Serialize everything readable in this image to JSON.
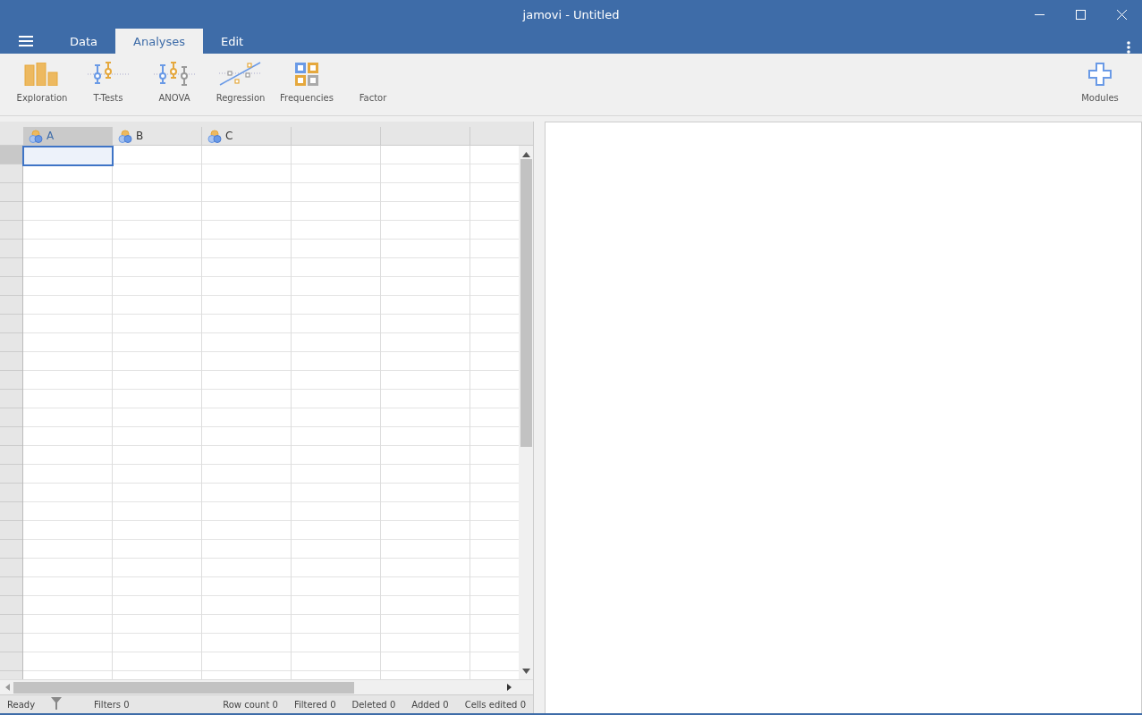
{
  "window": {
    "title": "jamovi - Untitled"
  },
  "tabs": [
    {
      "label": "Data",
      "selected": false
    },
    {
      "label": "Analyses",
      "selected": true
    },
    {
      "label": "Edit",
      "selected": false
    }
  ],
  "toolbar": [
    {
      "label": "Exploration"
    },
    {
      "label": "T-Tests"
    },
    {
      "label": "ANOVA"
    },
    {
      "label": "Regression"
    },
    {
      "label": "Frequencies"
    },
    {
      "label": "Factor"
    }
  ],
  "modules": {
    "label": "Modules"
  },
  "columns": [
    {
      "name": "A",
      "selected": true
    },
    {
      "name": "B",
      "selected": false
    },
    {
      "name": "C",
      "selected": false
    }
  ],
  "status_bar": {
    "state": "Ready",
    "filters": "Filters 0",
    "row_count": "Row count 0",
    "filtered": "Filtered 0",
    "deleted": "Deleted 0",
    "added": "Added 0",
    "cells_edited": "Cells edited 0"
  }
}
